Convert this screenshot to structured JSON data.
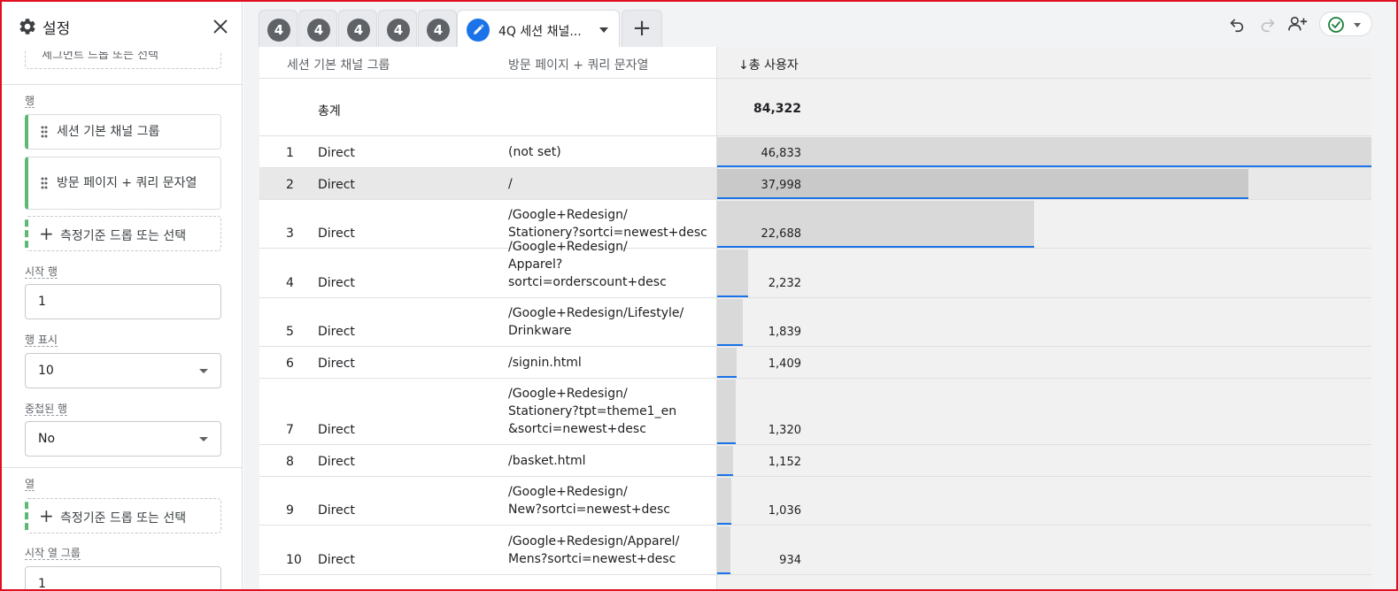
{
  "panel": {
    "title": "설정",
    "cut_text": "세그먼트 드롭 또는 선택",
    "rows_label": "행",
    "row_chips": [
      "세션 기본 채널 그룹",
      "방문 페이지 + 쿼리 문자열"
    ],
    "add_metric": "측정기준 드롭 또는 선택",
    "start_row_label": "시작 행",
    "start_row_value": "1",
    "show_rows_label": "행 표시",
    "show_rows_value": "10",
    "nested_rows_label": "중첩된 행",
    "nested_rows_value": "No",
    "columns_label": "열",
    "add_column_metric": "측정기준 드롭 또는 선택",
    "start_col_group_label": "시작 열 그룹",
    "start_col_group_value": "1"
  },
  "tabs": {
    "numbered": [
      "4",
      "4",
      "4",
      "4",
      "4"
    ],
    "active_label": "4Q 세션 채널...",
    "add": "+"
  },
  "table": {
    "headers": {
      "channel": "세션 기본 채널 그룹",
      "page": "방문 페이지 + 쿼리 문자열",
      "metric": "↓총 사용자"
    },
    "total_label": "총계",
    "total_value": "84,322",
    "max_value": 46833,
    "rows": [
      {
        "idx": "1",
        "channel": "Direct",
        "page": "(not set)",
        "value": "46,833",
        "v": 46833
      },
      {
        "idx": "2",
        "channel": "Direct",
        "page": "/",
        "value": "37,998",
        "v": 37998
      },
      {
        "idx": "3",
        "channel": "Direct",
        "page": "/Google+Redesign/\nStationery?sortci=newest+desc",
        "value": "22,688",
        "v": 22688
      },
      {
        "idx": "4",
        "channel": "Direct",
        "page": "/Google+Redesign/\nApparel?sortci=orderscount+desc",
        "value": "2,232",
        "v": 2232
      },
      {
        "idx": "5",
        "channel": "Direct",
        "page": "/Google+Redesign/Lifestyle/\nDrinkware",
        "value": "1,839",
        "v": 1839
      },
      {
        "idx": "6",
        "channel": "Direct",
        "page": "/signin.html",
        "value": "1,409",
        "v": 1409
      },
      {
        "idx": "7",
        "channel": "Direct",
        "page": "/Google+Redesign/\nStationery?tpt=theme1_en\n&sortci=newest+desc",
        "value": "1,320",
        "v": 1320
      },
      {
        "idx": "8",
        "channel": "Direct",
        "page": "/basket.html",
        "value": "1,152",
        "v": 1152
      },
      {
        "idx": "9",
        "channel": "Direct",
        "page": "/Google+Redesign/\nNew?sortci=newest+desc",
        "value": "1,036",
        "v": 1036
      },
      {
        "idx": "10",
        "channel": "Direct",
        "page": "/Google+Redesign/Apparel/\nMens?sortci=newest+desc",
        "value": "934",
        "v": 934
      }
    ]
  }
}
